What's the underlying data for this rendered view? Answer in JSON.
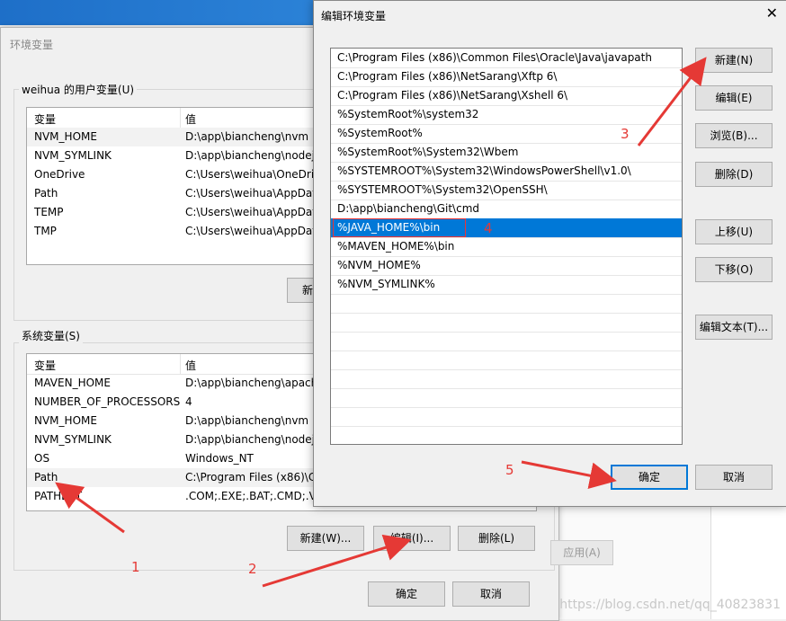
{
  "back_window": {
    "title": "环境变量",
    "user_vars_label": "weihua 的用户变量(U)",
    "columns": [
      "变量",
      "值"
    ],
    "user_vars": [
      {
        "name": "NVM_HOME",
        "value": "D:\\app\\biancheng\\nvm"
      },
      {
        "name": "NVM_SYMLINK",
        "value": "D:\\app\\biancheng\\nodej"
      },
      {
        "name": "OneDrive",
        "value": "C:\\Users\\weihua\\OneDriv"
      },
      {
        "name": "Path",
        "value": "C:\\Users\\weihua\\AppDat"
      },
      {
        "name": "TEMP",
        "value": "C:\\Users\\weihua\\AppDat"
      },
      {
        "name": "TMP",
        "value": "C:\\Users\\weihua\\AppDat"
      }
    ],
    "user_new_btn": "新",
    "system_vars_label": "系统变量(S)",
    "system_vars": [
      {
        "name": "MAVEN_HOME",
        "value": "D:\\app\\biancheng\\apach"
      },
      {
        "name": "NUMBER_OF_PROCESSORS",
        "value": "4"
      },
      {
        "name": "NVM_HOME",
        "value": "D:\\app\\biancheng\\nvm"
      },
      {
        "name": "NVM_SYMLINK",
        "value": "D:\\app\\biancheng\\nodej"
      },
      {
        "name": "OS",
        "value": "Windows_NT"
      },
      {
        "name": "Path",
        "value": "C:\\Program Files (x86)\\Co"
      },
      {
        "name": "PATHEXT",
        "value": ".COM;.EXE;.BAT;.CMD;.VE"
      }
    ],
    "sys_new_btn": "新建(W)...",
    "sys_edit_btn": "编辑(I)...",
    "sys_delete_btn": "删除(L)",
    "ok_btn": "确定",
    "cancel_btn": "取消",
    "apply_btn": "应用(A)"
  },
  "edit_dialog": {
    "title": "编辑环境变量",
    "close_glyph": "✕",
    "paths": [
      "C:\\Program Files (x86)\\Common Files\\Oracle\\Java\\javapath",
      "C:\\Program Files (x86)\\NetSarang\\Xftp 6\\",
      "C:\\Program Files (x86)\\NetSarang\\Xshell 6\\",
      "%SystemRoot%\\system32",
      "%SystemRoot%",
      "%SystemRoot%\\System32\\Wbem",
      "%SYSTEMROOT%\\System32\\WindowsPowerShell\\v1.0\\",
      "%SYSTEMROOT%\\System32\\OpenSSH\\",
      "D:\\app\\biancheng\\Git\\cmd",
      "%JAVA_HOME%\\bin",
      "%MAVEN_HOME%\\bin",
      "%NVM_HOME%",
      "%NVM_SYMLINK%"
    ],
    "selected_index": 9,
    "buttons": {
      "new": "新建(N)",
      "edit": "编辑(E)",
      "browse": "浏览(B)...",
      "delete": "删除(D)",
      "up": "上移(U)",
      "down": "下移(O)",
      "edit_text": "编辑文本(T)..."
    },
    "ok_btn": "确定",
    "cancel_btn": "取消"
  },
  "annotations": [
    "1",
    "2",
    "3",
    "4",
    "5"
  ],
  "watermark": "https://blog.csdn.net/qq_40823831",
  "colors": {
    "accent": "#0078d7",
    "annotation": "#e53935"
  }
}
